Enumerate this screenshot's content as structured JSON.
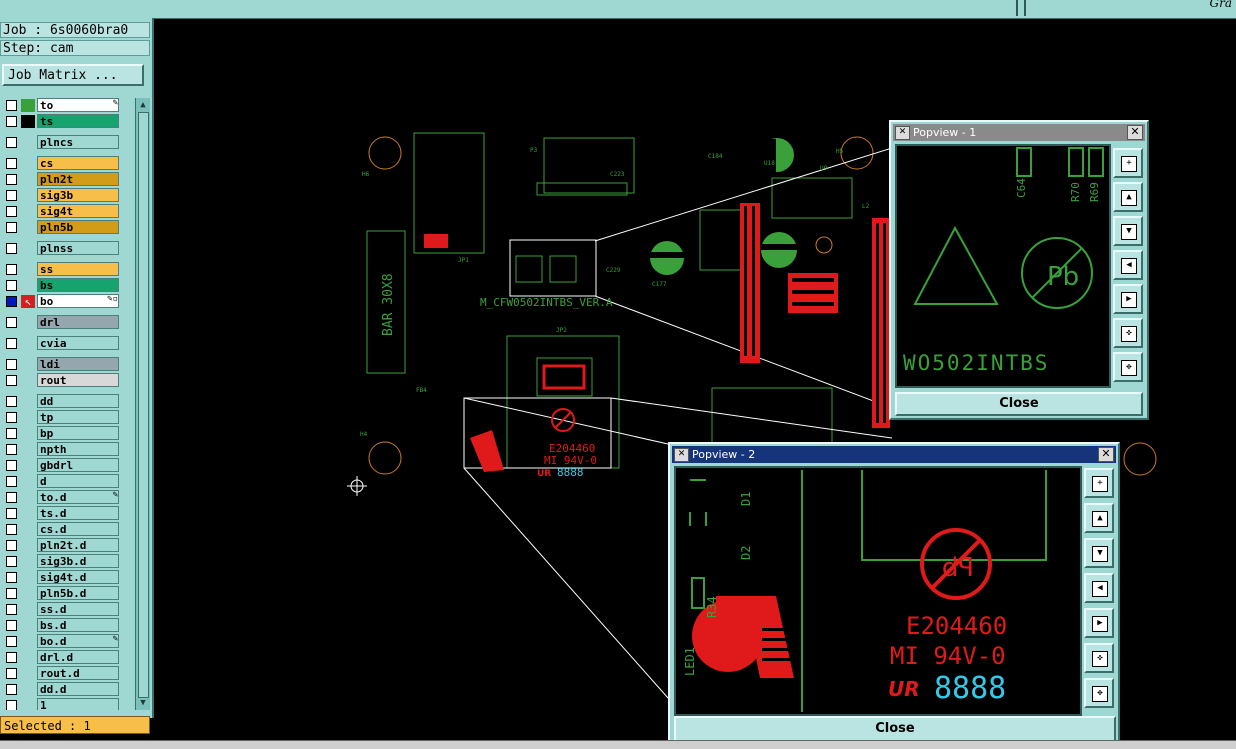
{
  "left_panel": {
    "job_line": "Job : 6s0060bra0",
    "step_line": "Step: cam",
    "job_matrix_button": "Job Matrix ...",
    "selected_status": "Selected : 1"
  },
  "top_bar": {
    "brand_fragment": "Gra"
  },
  "layers": [
    {
      "name": "to",
      "color": "#ffffff",
      "swatch": "#3aa13a",
      "mark": "✎"
    },
    {
      "name": "ts",
      "color": "#17a36e",
      "swatch": "#000000",
      "mark": ""
    },
    {
      "name": "plncs",
      "color": "#9fd7d3",
      "swatch": "",
      "mark": "",
      "gap": true
    },
    {
      "name": "cs",
      "color": "#f7be4a",
      "swatch": "",
      "mark": "",
      "gap": true
    },
    {
      "name": "pln2t",
      "color": "#d29c18",
      "swatch": "",
      "mark": ""
    },
    {
      "name": "sig3b",
      "color": "#f7be4a",
      "swatch": "",
      "mark": ""
    },
    {
      "name": "sig4t",
      "color": "#f7be4a",
      "swatch": "",
      "mark": ""
    },
    {
      "name": "pln5b",
      "color": "#d29c18",
      "swatch": "",
      "mark": ""
    },
    {
      "name": "plnss",
      "color": "#9fd7d3",
      "swatch": "",
      "mark": "",
      "gap": true
    },
    {
      "name": "ss",
      "color": "#f7be4a",
      "swatch": "",
      "mark": "",
      "gap": true
    },
    {
      "name": "bs",
      "color": "#17a36e",
      "swatch": "",
      "mark": ""
    },
    {
      "name": "bo",
      "color": "#ffffff",
      "swatch": "#d42020",
      "mark": "✎▫",
      "active": true
    },
    {
      "name": "drl",
      "color": "#96a6ae",
      "swatch": "",
      "mark": "",
      "gap": true
    },
    {
      "name": "cvia",
      "color": "#9fd7d3",
      "swatch": "",
      "mark": "",
      "gap": true
    },
    {
      "name": "ldi",
      "color": "#96a6ae",
      "swatch": "",
      "mark": "",
      "gap": true
    },
    {
      "name": "rout",
      "color": "#d8d8d8",
      "swatch": "",
      "mark": ""
    },
    {
      "name": "dd",
      "color": "#9fd7d3",
      "swatch": "",
      "mark": "",
      "gap": true
    },
    {
      "name": "tp",
      "color": "#9fd7d3",
      "swatch": "",
      "mark": ""
    },
    {
      "name": "bp",
      "color": "#9fd7d3",
      "swatch": "",
      "mark": ""
    },
    {
      "name": "npth",
      "color": "#9fd7d3",
      "swatch": "",
      "mark": ""
    },
    {
      "name": "gbdrl",
      "color": "#9fd7d3",
      "swatch": "",
      "mark": ""
    },
    {
      "name": "d",
      "color": "#9fd7d3",
      "swatch": "",
      "mark": ""
    },
    {
      "name": "to.d",
      "color": "#9fd7d3",
      "swatch": "",
      "mark": "✎"
    },
    {
      "name": "ts.d",
      "color": "#9fd7d3",
      "swatch": "",
      "mark": ""
    },
    {
      "name": "cs.d",
      "color": "#9fd7d3",
      "swatch": "",
      "mark": ""
    },
    {
      "name": "pln2t.d",
      "color": "#9fd7d3",
      "swatch": "",
      "mark": ""
    },
    {
      "name": "sig3b.d",
      "color": "#9fd7d3",
      "swatch": "",
      "mark": ""
    },
    {
      "name": "sig4t.d",
      "color": "#9fd7d3",
      "swatch": "",
      "mark": ""
    },
    {
      "name": "pln5b.d",
      "color": "#9fd7d3",
      "swatch": "",
      "mark": ""
    },
    {
      "name": "ss.d",
      "color": "#9fd7d3",
      "swatch": "",
      "mark": ""
    },
    {
      "name": "bs.d",
      "color": "#9fd7d3",
      "swatch": "",
      "mark": ""
    },
    {
      "name": "bo.d",
      "color": "#9fd7d3",
      "swatch": "",
      "mark": "✎"
    },
    {
      "name": "drl.d",
      "color": "#9fd7d3",
      "swatch": "",
      "mark": ""
    },
    {
      "name": "rout.d",
      "color": "#9fd7d3",
      "swatch": "",
      "mark": ""
    },
    {
      "name": "dd.d",
      "color": "#9fd7d3",
      "swatch": "",
      "mark": ""
    },
    {
      "name": "1",
      "color": "#9fd7d3",
      "swatch": "",
      "mark": ""
    }
  ],
  "pcb": {
    "bar_label": "BAR 30X8",
    "board_label": "M_CFW0502INTBS_VER.A",
    "silk_labels": [
      "H6",
      "H5",
      "H4",
      "P3",
      "JP1",
      "JP2",
      "FB4",
      "C177",
      "C229",
      "C184",
      "U18",
      "C223",
      "U9",
      "L2"
    ],
    "ul_code": "E204460",
    "ul_rating": "MI 94V-0",
    "ur_mark": "UR",
    "date_code": "8888"
  },
  "popview1": {
    "title": "Popview - 1",
    "close_label": "Close",
    "text_wo": "WO502INTBS",
    "ref_labels": [
      "C64",
      "R70",
      "R69"
    ]
  },
  "popview2": {
    "title": "Popview - 2",
    "close_label": "Close",
    "ref_labels": [
      "D1",
      "D2",
      "R34",
      "LED1"
    ],
    "ul_code": "E204460",
    "ul_rating": "MI 94V-0",
    "date_code": "8888"
  },
  "colors": {
    "panel": "#9fd7d3",
    "silk_green": "#3aa13a",
    "copper_red": "#e01a1a",
    "pad_orange": "#c97a2a",
    "outline_white": "#ffffff",
    "digit_cyan": "#36c8e8"
  }
}
